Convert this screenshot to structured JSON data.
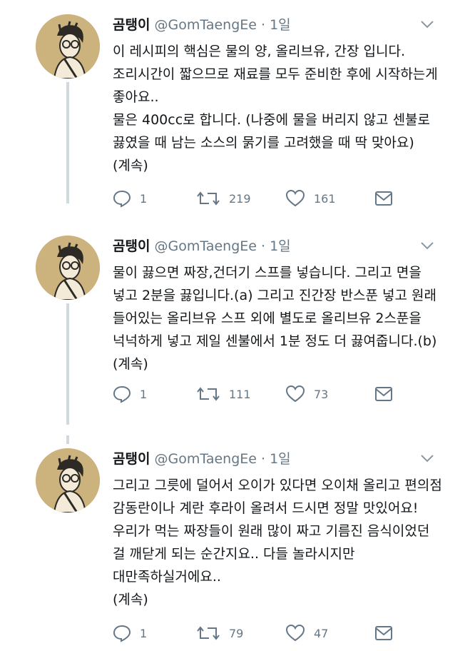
{
  "tweets": [
    {
      "name": "곰탱이",
      "handle": "@GomTaengEe",
      "separator": "·",
      "time": "1일",
      "lines": [
        "이 레시피의 핵심은 물의 양, 올리브유, 간장 입니다.",
        "조리시간이 짧으므로 재료를 모두 준비한 후에 시작하는게",
        "좋아요..",
        "물은 400cc로 합니다. (나중에 물을 버리지 않고 센불로",
        "끓였을 때 남는 소스의 묽기를 고려했을 때 딱 맞아요)",
        "(계속)"
      ],
      "replies": "1",
      "retweets": "219",
      "likes": "161"
    },
    {
      "name": "곰탱이",
      "handle": "@GomTaengEe",
      "separator": "·",
      "time": "1일",
      "lines": [
        "물이 끓으면 짜장,건더기 스프를 넣습니다. 그리고 면을",
        "넣고 2분을 끓입니다.(a) 그리고 진간장 반스푼 넣고 원래",
        "들어있는 올리브유 스프 외에 별도로 올리브유 2스푼을",
        "넉넉하게 넣고 제일 센불에서 1분 정도 더 끓여줍니다.(b)",
        "(계속)"
      ],
      "replies": "1",
      "retweets": "111",
      "likes": "73"
    },
    {
      "name": "곰탱이",
      "handle": "@GomTaengEe",
      "separator": "·",
      "time": "1일",
      "lines": [
        "그리고 그릇에 덜어서 오이가 있다면 오이채 올리고 편의점",
        "감동란이나 계란 후라이 올려서 드시면 정말 맛있어요!",
        "우리가 먹는 짜장들이 원래 많이 짜고 기름진 음식이었던",
        "걸 깨닫게 되는 순간지요.. 다들 놀라시지만",
        "대만족하실거에요..",
        "(계속)"
      ],
      "replies": "1",
      "retweets": "79",
      "likes": "47"
    }
  ],
  "icons": {
    "reply": "reply-icon",
    "retweet": "retweet-icon",
    "like": "heart-icon",
    "dm": "envelope-icon",
    "caret": "chevron-down-icon"
  },
  "colors": {
    "avatar_bg": "#ccb27d",
    "meta_gray": "#657786",
    "thread_line": "#cfd9de"
  }
}
